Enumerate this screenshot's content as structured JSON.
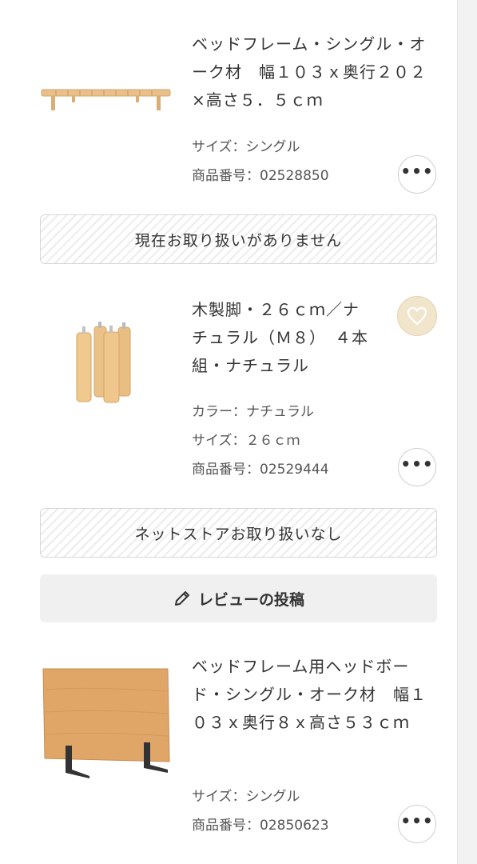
{
  "products": [
    {
      "title": "ベッドフレーム・シングル・オーク材　幅１０３ｘ奥行２０２×高さ５．５ｃｍ",
      "size": "サイズ：シングル",
      "code": "商品番号：02528850",
      "more_label": "•••"
    },
    {
      "title": "木製脚・２６ｃｍ／ナチュラル（Ｍ８）　４本組・ナチュラル",
      "color": "カラー：ナチュラル",
      "size": "サイズ：２６ｃｍ",
      "code": "商品番号：02529444",
      "more_label": "•••"
    },
    {
      "title": "ベッドフレーム用ヘッドボード・シングル・オーク材　幅１０３ｘ奥行８ｘ高さ５３ｃｍ",
      "size": "サイズ：シングル",
      "code": "商品番号：02850623",
      "more_label": "•••"
    }
  ],
  "notices": {
    "not_handled": "現在お取り扱いがありません",
    "not_in_netstore": "ネットストアお取り扱いなし"
  },
  "review": {
    "label": "レビューの投稿"
  },
  "icons": {
    "favorite": "heart-icon",
    "more": "more-dots-icon",
    "review": "pencil-icon"
  },
  "colors": {
    "favorite_bg": "#f1e5cc",
    "wood": "#e8b97a"
  }
}
